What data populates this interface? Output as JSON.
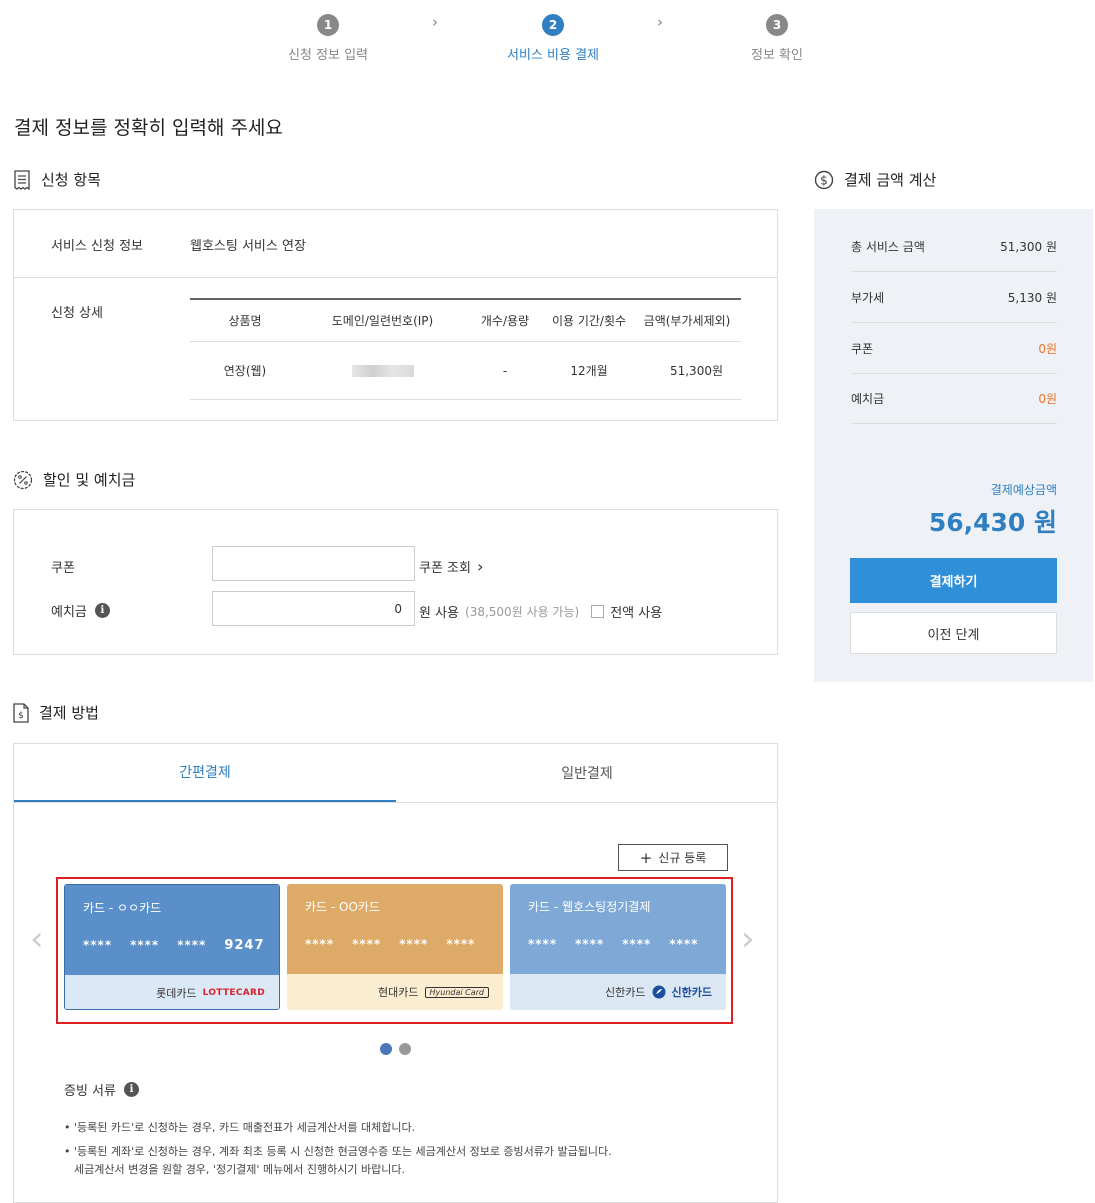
{
  "stepper": {
    "steps": [
      {
        "num": "1",
        "label": "신청 정보 입력"
      },
      {
        "num": "2",
        "label": "서비스 비용 결제"
      },
      {
        "num": "3",
        "label": "정보 확인"
      }
    ]
  },
  "page": {
    "title": "결제 정보를 정확히 입력해 주세요"
  },
  "application": {
    "section_title": "신청 항목",
    "service_label": "서비스 신청 정보",
    "service_value": "웹호스팅 서비스 연장",
    "detail_label": "신청 상세",
    "columns": [
      "상품명",
      "도메인/일련번호(IP)",
      "개수/용량",
      "이용 기간/횟수",
      "금액(부가세제외)"
    ],
    "rows": [
      {
        "product": "연장(웹)",
        "count": "-",
        "period": "12개월",
        "amount": "51,300원"
      }
    ]
  },
  "discount": {
    "section_title": "할인 및 예치금",
    "coupon_label": "쿠폰",
    "coupon_lookup": "쿠폰 조회",
    "deposit_label": "예치금",
    "deposit_value": "0",
    "deposit_unit": "원 사용",
    "deposit_available": "(38,500원 사용 가능)",
    "use_all_label": "전액 사용"
  },
  "payment": {
    "section_title": "결제 방법",
    "tabs": [
      "간편결제",
      "일반결제"
    ],
    "new_register": "신규 등록",
    "cards": [
      {
        "name": "카드 - ㅇㅇ카드",
        "num": [
          "****",
          "****",
          "****",
          "9247"
        ],
        "issuer": "롯데카드",
        "logo": "LOTTECARD"
      },
      {
        "name": "카드 - OO카드",
        "num": [
          "****",
          "****",
          "****",
          "****"
        ],
        "issuer": "현대카드",
        "logo": "Hyundai Card"
      },
      {
        "name": "카드 - 웹호스팅정기결제",
        "num": [
          "****",
          "****",
          "****",
          "****"
        ],
        "issuer": "신한카드",
        "logo": "신한카드"
      }
    ],
    "proof_title": "증빙 서류",
    "notes": [
      "'등록된 카드'로 신청하는 경우, 카드 매출전표가 세금계산서를 대체합니다.",
      "'등록된 계좌'로 신청하는 경우, 계좌 최초 등록 시 신청한 현금영수증 또는 세금계산서 정보로 증빙서류가 발급됩니다.",
      "세금계산서 변경을 원할 경우, '정기결제' 메뉴에서 진행하시기 바랍니다."
    ]
  },
  "summary": {
    "section_title": "결제 금액 계산",
    "rows": [
      {
        "label": "총 서비스 금액",
        "value": "51,300 원"
      },
      {
        "label": "부가세",
        "value": "5,130 원"
      },
      {
        "label": "쿠폰",
        "value": "0원"
      },
      {
        "label": "예치금",
        "value": "0원"
      }
    ],
    "expected_label": "결제예상금액",
    "expected_amount": "56,430 원",
    "pay_button": "결제하기",
    "prev_button": "이전 단계"
  },
  "colors": {
    "accent": "#2f7fc1",
    "orange": "#e8742a",
    "card1": "#5b8fca",
    "card2": "#deaa68",
    "card3": "#7ea8d6",
    "highlight": "#e02020"
  }
}
